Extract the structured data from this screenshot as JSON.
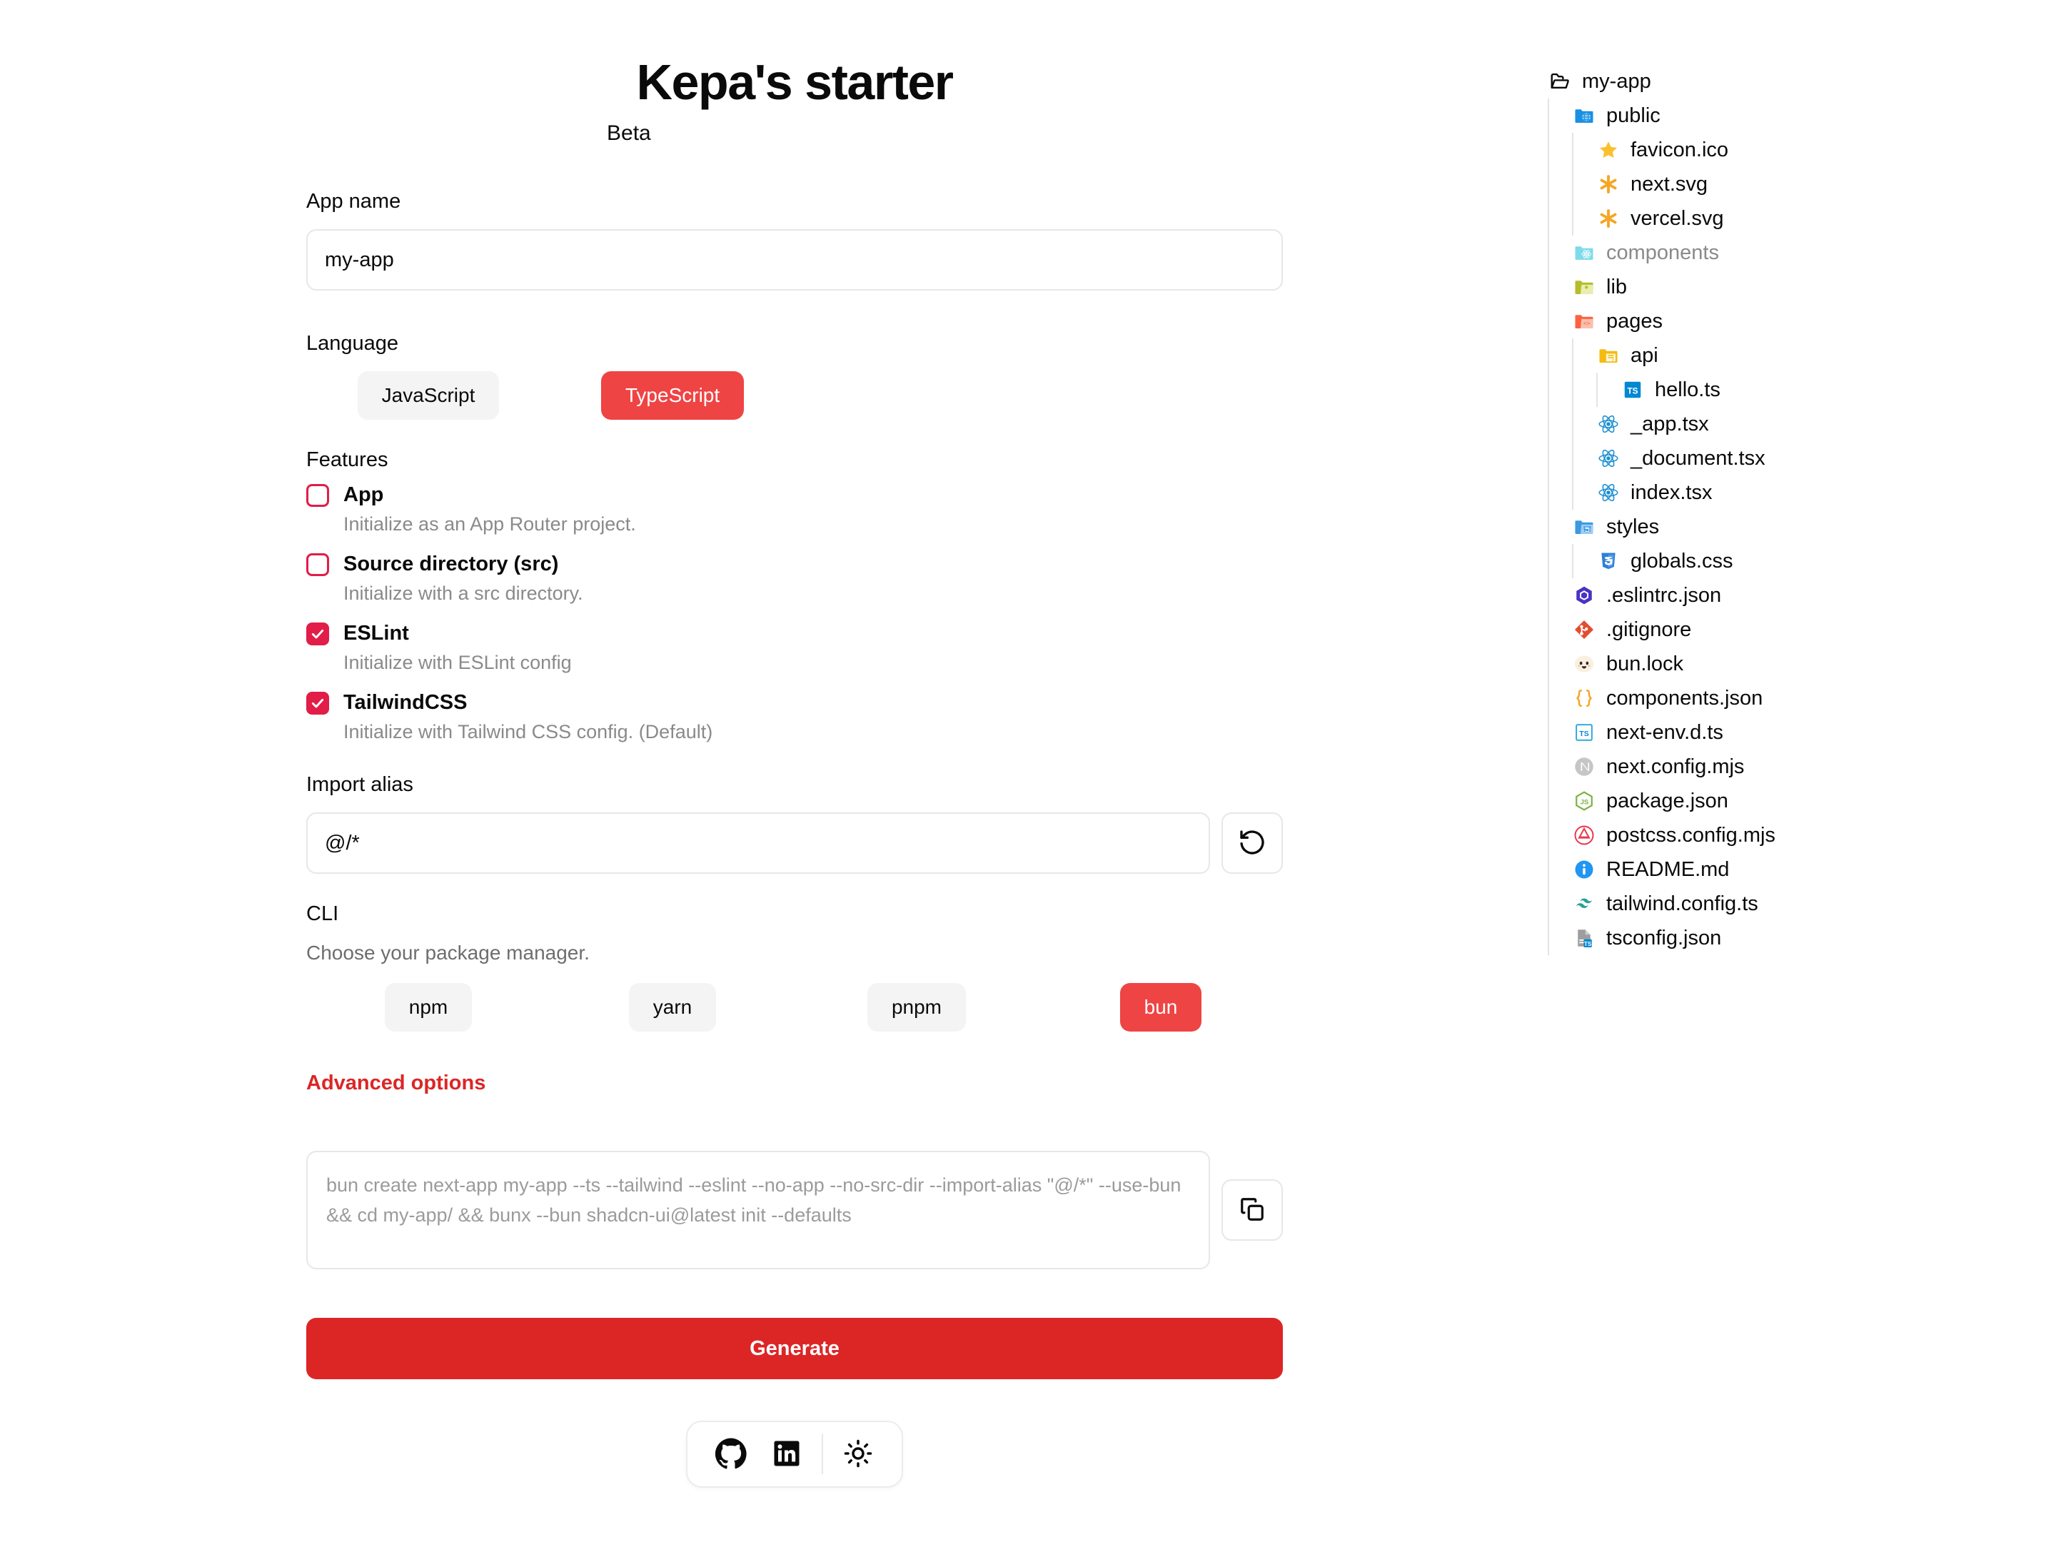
{
  "header": {
    "title": "Kepa's starter",
    "subtitle": "Beta"
  },
  "app_name": {
    "label": "App name",
    "value": "my-app",
    "placeholder": "my-app"
  },
  "language": {
    "label": "Language",
    "options": [
      {
        "label": "JavaScript",
        "active": false
      },
      {
        "label": "TypeScript",
        "active": true
      }
    ]
  },
  "features": {
    "label": "Features",
    "items": [
      {
        "name": "App",
        "desc": "Initialize as an App Router project.",
        "checked": false
      },
      {
        "name": "Source directory (src)",
        "desc": "Initialize with a src directory.",
        "checked": false
      },
      {
        "name": "ESLint",
        "desc": "Initialize with ESLint config",
        "checked": true
      },
      {
        "name": "TailwindCSS",
        "desc": "Initialize with Tailwind CSS config. (Default)",
        "checked": true
      }
    ]
  },
  "import_alias": {
    "label": "Import alias",
    "value": "@/*",
    "placeholder": "@/*",
    "reset_icon": "reset-icon"
  },
  "cli": {
    "label": "CLI",
    "sub": "Choose your package manager.",
    "managers": [
      {
        "label": "npm",
        "active": false
      },
      {
        "label": "yarn",
        "active": false
      },
      {
        "label": "pnpm",
        "active": false
      },
      {
        "label": "bun",
        "active": true
      }
    ]
  },
  "advanced": {
    "label": "Advanced options"
  },
  "command": {
    "text": "bun create next-app my-app --ts --tailwind --eslint --no-app --no-src-dir --import-alias \"@/*\" --use-bun && cd my-app/ && bunx --bun shadcn-ui@latest init --defaults",
    "copy_icon": "copy-icon"
  },
  "generate": {
    "label": "Generate"
  },
  "footer": {
    "buttons": [
      {
        "icon": "github-icon"
      },
      {
        "icon": "linkedin-icon"
      },
      {
        "icon": "sun-icon"
      }
    ]
  },
  "colors": {
    "accent": "#dc2626",
    "pill_active": "#ef4444",
    "checkbox": "#e11d48",
    "muted": "#8a8a8a"
  },
  "tree": {
    "nodes": [
      {
        "name": "my-app",
        "depth": 0,
        "icon": "folder-open-icon",
        "dim": false
      },
      {
        "name": "public",
        "depth": 1,
        "icon": "folder-public-icon",
        "dim": false
      },
      {
        "name": "favicon.ico",
        "depth": 2,
        "icon": "star-icon",
        "dim": false
      },
      {
        "name": "next.svg",
        "depth": 2,
        "icon": "svg-icon",
        "dim": false
      },
      {
        "name": "vercel.svg",
        "depth": 2,
        "icon": "svg-icon",
        "dim": false
      },
      {
        "name": "components",
        "depth": 1,
        "icon": "folder-components-icon",
        "dim": true
      },
      {
        "name": "lib",
        "depth": 1,
        "icon": "folder-lib-icon",
        "dim": false
      },
      {
        "name": "pages",
        "depth": 1,
        "icon": "folder-pages-icon",
        "dim": false
      },
      {
        "name": "api",
        "depth": 2,
        "icon": "folder-api-icon",
        "dim": false
      },
      {
        "name": "hello.ts",
        "depth": 3,
        "icon": "ts-icon",
        "dim": false
      },
      {
        "name": "_app.tsx",
        "depth": 2,
        "icon": "react-icon",
        "dim": false
      },
      {
        "name": "_document.tsx",
        "depth": 2,
        "icon": "react-icon",
        "dim": false
      },
      {
        "name": "index.tsx",
        "depth": 2,
        "icon": "react-icon",
        "dim": false
      },
      {
        "name": "styles",
        "depth": 1,
        "icon": "folder-styles-icon",
        "dim": false
      },
      {
        "name": "globals.css",
        "depth": 2,
        "icon": "css-icon",
        "dim": false
      },
      {
        "name": ".eslintrc.json",
        "depth": 1,
        "icon": "eslint-icon",
        "dim": false
      },
      {
        "name": ".gitignore",
        "depth": 1,
        "icon": "git-icon",
        "dim": false
      },
      {
        "name": "bun.lock",
        "depth": 1,
        "icon": "bun-icon",
        "dim": false
      },
      {
        "name": "components.json",
        "depth": 1,
        "icon": "json-icon",
        "dim": false
      },
      {
        "name": "next-env.d.ts",
        "depth": 1,
        "icon": "ts-def-icon",
        "dim": false
      },
      {
        "name": "next.config.mjs",
        "depth": 1,
        "icon": "next-icon",
        "dim": false
      },
      {
        "name": "package.json",
        "depth": 1,
        "icon": "node-icon",
        "dim": false
      },
      {
        "name": "postcss.config.mjs",
        "depth": 1,
        "icon": "postcss-icon",
        "dim": false
      },
      {
        "name": "README.md",
        "depth": 1,
        "icon": "info-icon",
        "dim": false
      },
      {
        "name": "tailwind.config.ts",
        "depth": 1,
        "icon": "tailwind-icon",
        "dim": false
      },
      {
        "name": "tsconfig.json",
        "depth": 1,
        "icon": "tsconfig-icon",
        "dim": false
      }
    ]
  }
}
